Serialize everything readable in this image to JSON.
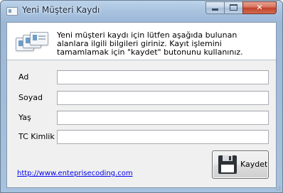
{
  "window": {
    "title": "Yeni Müşteri Kaydı",
    "close_glyph": "✕"
  },
  "header": {
    "icon": "customer-cards-icon",
    "text": "Yeni müşteri kaydı için lütfen aşağıda bulunan alanlara ilgili bilgileri giriniz. Kayıt işlemini tamamlamak için \"kaydet\" butonunu kullanınız."
  },
  "form": {
    "fields": [
      {
        "label": "Ad",
        "value": ""
      },
      {
        "label": "Soyad",
        "value": ""
      },
      {
        "label": "Yaş",
        "value": ""
      },
      {
        "label": "TC Kimlik",
        "value": ""
      }
    ]
  },
  "footer": {
    "link_text": "http://www.enteprisecoding.com",
    "save_label": "Kaydet",
    "save_icon": "floppy-disk-icon"
  }
}
